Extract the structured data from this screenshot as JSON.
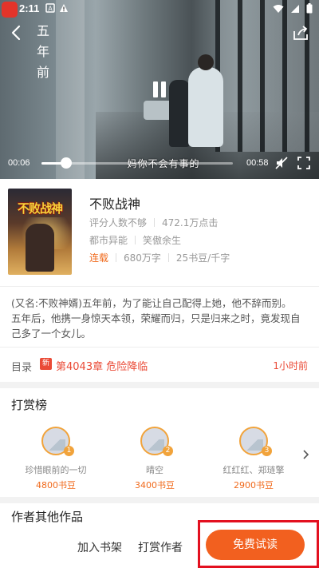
{
  "status_bar": {
    "time": "2:11"
  },
  "video": {
    "vertical_title": [
      "五",
      "年",
      "前"
    ],
    "subtitle": "妈你不会有事的",
    "current_time": "00:06",
    "total_time": "00:58",
    "progress": 0.13
  },
  "book": {
    "cover_text": "不败战神",
    "title": "不败战神",
    "rating": "评分人数不够",
    "clicks": "472.1万点击",
    "category": "都市异能",
    "author": "笑傲余生",
    "status": "连载",
    "word_count": "680万字",
    "price": "25书豆/千字"
  },
  "description": "(又名:不败神婿)五年前，为了能让自己配得上她，他不辞而别。\n五年后，他携一身惊天本领，荣耀而归，只是归来之时，竟发现自己多了一个女儿。",
  "toc": {
    "label": "目录",
    "badge": "新",
    "latest_chapter": "第4043章 危险降临",
    "updated": "1小时前"
  },
  "reward_rank": {
    "title": "打赏榜",
    "items": [
      {
        "rank": "1",
        "name": "珍惜眼前的一切",
        "amount": "4800书豆"
      },
      {
        "rank": "2",
        "name": "晴空",
        "amount": "3400书豆"
      },
      {
        "rank": "3",
        "name": "红红红、郑琏擎",
        "amount": "2900书豆"
      }
    ]
  },
  "other_works": {
    "title": "作者其他作品"
  },
  "bottom_bar": {
    "add_shelf": "加入书架",
    "reward_author": "打赏作者",
    "free_trial": "免费试读"
  },
  "colors": {
    "accent": "#f2601f",
    "chapter_red": "#ea4a36",
    "highlight": "#e3101f"
  }
}
